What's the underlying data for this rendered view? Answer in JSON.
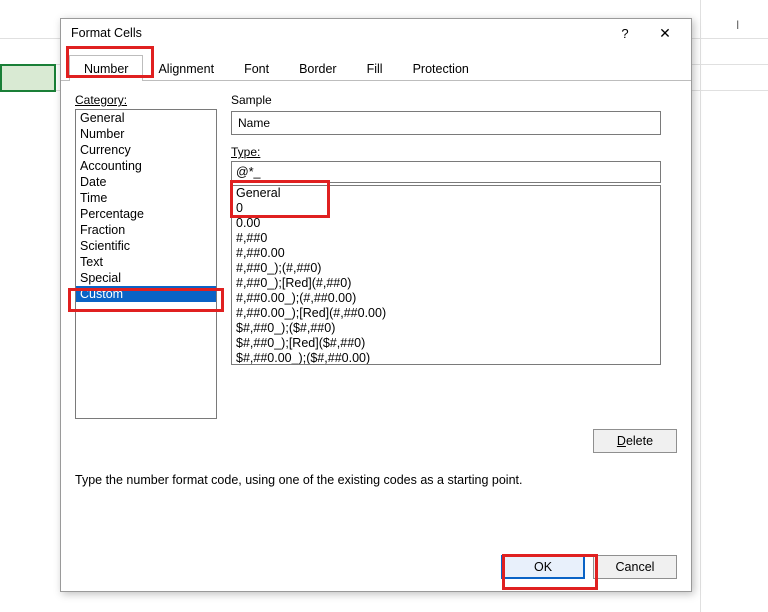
{
  "dialog": {
    "title": "Format Cells",
    "help_glyph": "?",
    "close_glyph": "✕"
  },
  "tabs": [
    {
      "label": "Number",
      "active": true
    },
    {
      "label": "Alignment"
    },
    {
      "label": "Font"
    },
    {
      "label": "Border"
    },
    {
      "label": "Fill"
    },
    {
      "label": "Protection"
    }
  ],
  "category_label": "Category:",
  "categories": [
    "General",
    "Number",
    "Currency",
    "Accounting",
    "Date",
    "Time",
    "Percentage",
    "Fraction",
    "Scientific",
    "Text",
    "Special",
    "Custom"
  ],
  "selected_category_index": 11,
  "sample": {
    "label": "Sample",
    "value": "Name"
  },
  "type": {
    "label": "Type:",
    "value": "@*_"
  },
  "format_list": [
    "General",
    "0",
    "0.00",
    "#,##0",
    "#,##0.00",
    "#,##0_);(#,##0)",
    "#,##0_);[Red](#,##0)",
    "#,##0.00_);(#,##0.00)",
    "#,##0.00_);[Red](#,##0.00)",
    "$#,##0_);($#,##0)",
    "$#,##0_);[Red]($#,##0)",
    "$#,##0.00_);($#,##0.00)"
  ],
  "buttons": {
    "delete": "Delete",
    "ok": "OK",
    "cancel": "Cancel"
  },
  "hint": "Type the number format code, using one of the existing codes as a starting point.",
  "spreadsheet": {
    "visible_column": "I"
  }
}
